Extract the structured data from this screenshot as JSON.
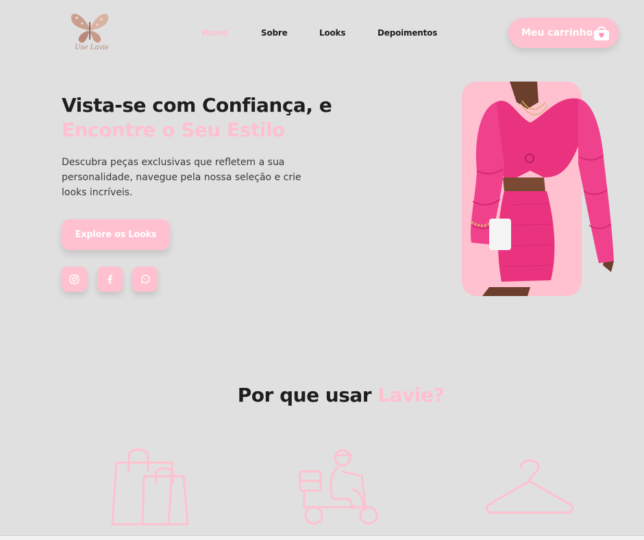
{
  "header": {
    "logo_text": "Use Lavie",
    "nav": [
      {
        "label": "Home",
        "active": true
      },
      {
        "label": "Sobre",
        "active": false
      },
      {
        "label": "Looks",
        "active": false
      },
      {
        "label": "Depoimentos",
        "active": false
      }
    ],
    "cart_label": "Meu carrinho",
    "cart_icon": "shopping-bag-heart-icon"
  },
  "hero": {
    "title_line1": "Vista-se com Confiança, e",
    "title_line2": "Encontre o Seu Estilo",
    "description": "Descubra peças exclusivas que refletem a sua personalidade, navegue pela nossa seleção e crie looks incríveis.",
    "cta_label": "Explore os Looks",
    "social_icons": [
      "instagram-icon",
      "facebook-icon",
      "whatsapp-icon"
    ],
    "image_subject": "model-in-pink-outfit"
  },
  "why": {
    "title_prefix": "Por que usar",
    "title_highlight": "Lavie?",
    "feature_icons": [
      "shopping-bags-icon",
      "delivery-scooter-icon",
      "clothes-hanger-icon"
    ]
  },
  "colors": {
    "background": "#e0e0e0",
    "accent_pink": "#ffc0cf",
    "dark_text": "#1e1e1e",
    "hot_pink": "#e9337e"
  }
}
